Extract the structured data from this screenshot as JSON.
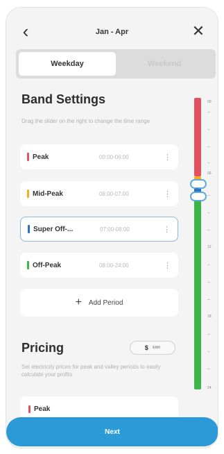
{
  "header": {
    "title": "Jan - Apr"
  },
  "tabs": [
    {
      "label": "Weekday",
      "active": true
    },
    {
      "label": "Weekend",
      "active": false
    }
  ],
  "band_settings": {
    "title": "Band Settings",
    "description": "Drag the slider on the right to change the time range",
    "periods": [
      {
        "name": "Peak",
        "time": "00:00-06:00",
        "color": "#e05260"
      },
      {
        "name": "Mid-Peak",
        "time": "06:00-07:00",
        "color": "#f2b01e"
      },
      {
        "name": "Super Off-...",
        "time": "07:00-08:00",
        "color": "#2f6fc2"
      },
      {
        "name": "Off-Peak",
        "time": "08:00-24:00",
        "color": "#3bb54a"
      }
    ],
    "add_label": "Add Period"
  },
  "pricing": {
    "title": "Pricing",
    "currency": "$",
    "unit": "/kWh",
    "description": "Set electricity prices for peak and valley periods to easily calculate your profits",
    "first_item": "Peak"
  },
  "slider": {
    "labels": [
      "00",
      "06",
      "12",
      "18",
      "24"
    ]
  },
  "next_label": "Next",
  "colors": {
    "accent": "#2b9ad6",
    "peak": "#e05260",
    "mid_peak": "#f2b01e",
    "super_off_peak": "#2f6fc2",
    "off_peak": "#3bb54a"
  }
}
